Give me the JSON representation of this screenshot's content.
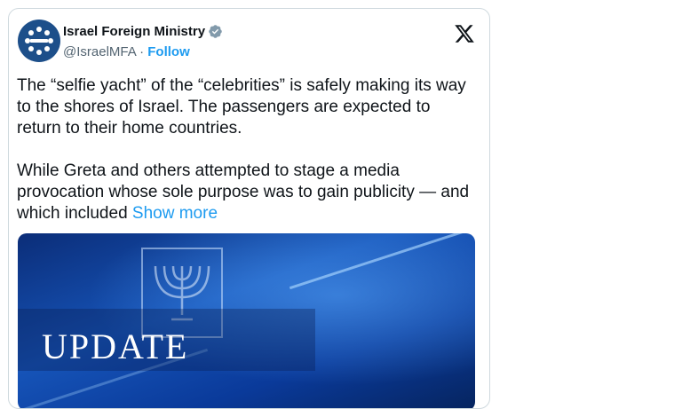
{
  "author": {
    "display_name": "Israel Foreign Ministry",
    "handle": "@IsraelMFA",
    "separator": " · ",
    "follow_label": "Follow",
    "verified_color": "#829aab"
  },
  "tweet": {
    "paragraph1": "The “selfie yacht” of the “celebrities” is safely making its way to the shores of Israel. The passengers are expected to return to their home countries.",
    "paragraph2": "While Greta and others attempted to stage a media provocation whose sole purpose was to gain publicity — and which included",
    "show_more": "Show more"
  },
  "media": {
    "overlay_text": "UPDATE"
  },
  "icons": [
    "avatar-emblem-icon",
    "verified-badge-icon",
    "x-logo-icon",
    "menorah-emblem-icon"
  ],
  "colors": {
    "link": "#1d9bf0",
    "text": "#0f1419",
    "secondary": "#536471",
    "border": "#cfd9de"
  }
}
